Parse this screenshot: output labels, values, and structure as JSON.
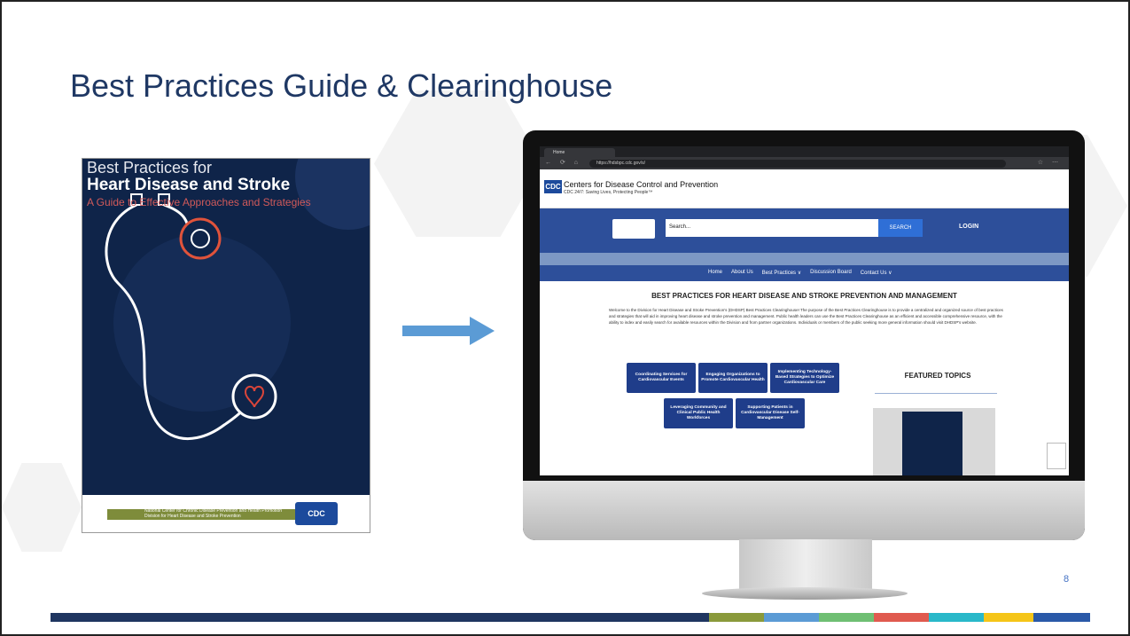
{
  "slide": {
    "title": "Best Practices Guide & Clearinghouse",
    "page_number": "8"
  },
  "guide_cover": {
    "title_line1": "Best Practices for",
    "title_line2": "Heart Disease and Stroke",
    "subtitle": "A Guide to Effective Approaches and Strategies",
    "footer_line1": "National Center for Chronic Disease Prevention and Health Promotion",
    "footer_line2": "Division for Heart Disease and Stroke Prevention",
    "badge": "CDC"
  },
  "browser": {
    "tab_label": "Home",
    "url": "https://hdsbpc.cdc.gov/s/"
  },
  "website": {
    "org_name": "Centers for Disease Control and Prevention",
    "tagline": "CDC 24/7: Saving Lives, Protecting People™",
    "logo_text": "CDC",
    "search_placeholder": "Search...",
    "search_button": "SEARCH",
    "login": "LOGIN",
    "nav": [
      "Home",
      "About Us",
      "Best Practices ∨",
      "Discussion Board",
      "Contact Us ∨"
    ],
    "heading": "BEST PRACTICES FOR HEART DISEASE AND STROKE PREVENTION AND MANAGEMENT",
    "intro": "Welcome to the Division for Heart Disease and Stroke Prevention's (DHDSP) Best Practices Clearinghouse! The purpose of the Best Practices Clearinghouse is to provide a centralized and organized source of best practices and strategies that will aid in improving heart disease and stroke prevention and management. Public health leaders can use the Best Practices Clearinghouse as an efficient and accessible comprehensive resource, with the ability to index and easily search for available resources within the Division and from partner organizations. Individuals or members of the public seeking more general information should visit DHDSP's website.",
    "cards": [
      "Coordinating Services for Cardiovascular Events",
      "Engaging Organizations to Promote Cardiovascular Health",
      "Implementing Technology-Based Strategies to Optimize Cardiovascular Care",
      "Leveraging Community and Clinical Public Health Workforces",
      "Supporting Patients in Cardiovascular Disease Self-Management"
    ],
    "featured_heading": "FEATURED TOPICS"
  }
}
